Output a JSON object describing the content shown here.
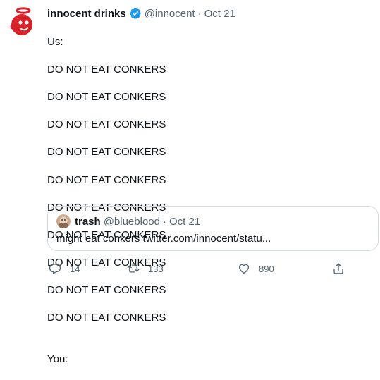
{
  "tweet": {
    "author_name": "innocent drinks",
    "author_handle": "@innocent",
    "separator": "·",
    "date": "Oct 21",
    "lines": [
      "Us:",
      "DO NOT EAT CONKERS",
      "DO NOT EAT CONKERS",
      "DO NOT EAT CONKERS",
      "DO NOT EAT CONKERS",
      "DO NOT EAT CONKERS",
      "DO NOT EAT CONKERS",
      "DO NOT EAT CONKERS",
      "DO NOT EAT CONKERS",
      "DO NOT EAT CONKERS",
      "DO NOT EAT CONKERS"
    ],
    "closing_line": "You:"
  },
  "quote": {
    "author_name": "trash",
    "author_handle": "@blueblood",
    "separator": "·",
    "date": "Oct 21",
    "text": "might eat conkers twitter.com/innocent/statu..."
  },
  "actions": {
    "reply_count": "14",
    "retweet_count": "133",
    "like_count": "890"
  },
  "icons": {
    "verified": "verified-badge-icon",
    "reply": "reply-icon",
    "retweet": "retweet-icon",
    "like": "heart-icon",
    "share": "share-icon"
  },
  "colors": {
    "verified_blue": "#1d9bf0",
    "logo_red": "#d8232a",
    "secondary_text": "#536471",
    "border": "#cfd9de"
  }
}
